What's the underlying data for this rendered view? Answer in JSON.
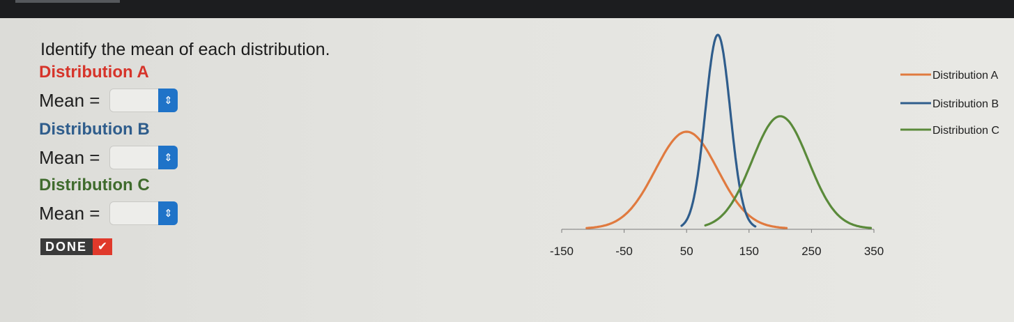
{
  "question": {
    "prompt": "Identify the mean of each distribution.",
    "items": [
      {
        "heading": "Distribution A",
        "mean_label": "Mean =",
        "value": "",
        "color": "#d6342a"
      },
      {
        "heading": "Distribution B",
        "mean_label": "Mean =",
        "value": "",
        "color": "#2f5d8c"
      },
      {
        "heading": "Distribution C",
        "mean_label": "Mean =",
        "value": "",
        "color": "#3f6b2d"
      }
    ],
    "done_label": "DONE",
    "done_icon": "checkmark-icon",
    "spinner_icon": "up-down-chevron-icon",
    "spinner_glyph": "⇕"
  },
  "chart_data": {
    "type": "line",
    "title": "",
    "xlabel": "",
    "ylabel": "",
    "x_ticks": [
      -150,
      -50,
      50,
      150,
      250,
      350
    ],
    "xlim": [
      -150,
      350
    ],
    "legend_position": "top-right",
    "series": [
      {
        "name": "Distribution A",
        "color": "#e07a3f",
        "mean": 50,
        "sd": 50,
        "x_range": [
          -110,
          210
        ],
        "peak": 0.5
      },
      {
        "name": "Distribution B",
        "color": "#2f5d8c",
        "mean": 100,
        "sd": 20,
        "x_range": [
          42,
          160
        ],
        "peak": 1.0
      },
      {
        "name": "Distribution C",
        "color": "#5a8a3a",
        "mean": 200,
        "sd": 45,
        "x_range": [
          80,
          345
        ],
        "peak": 0.58
      }
    ]
  }
}
